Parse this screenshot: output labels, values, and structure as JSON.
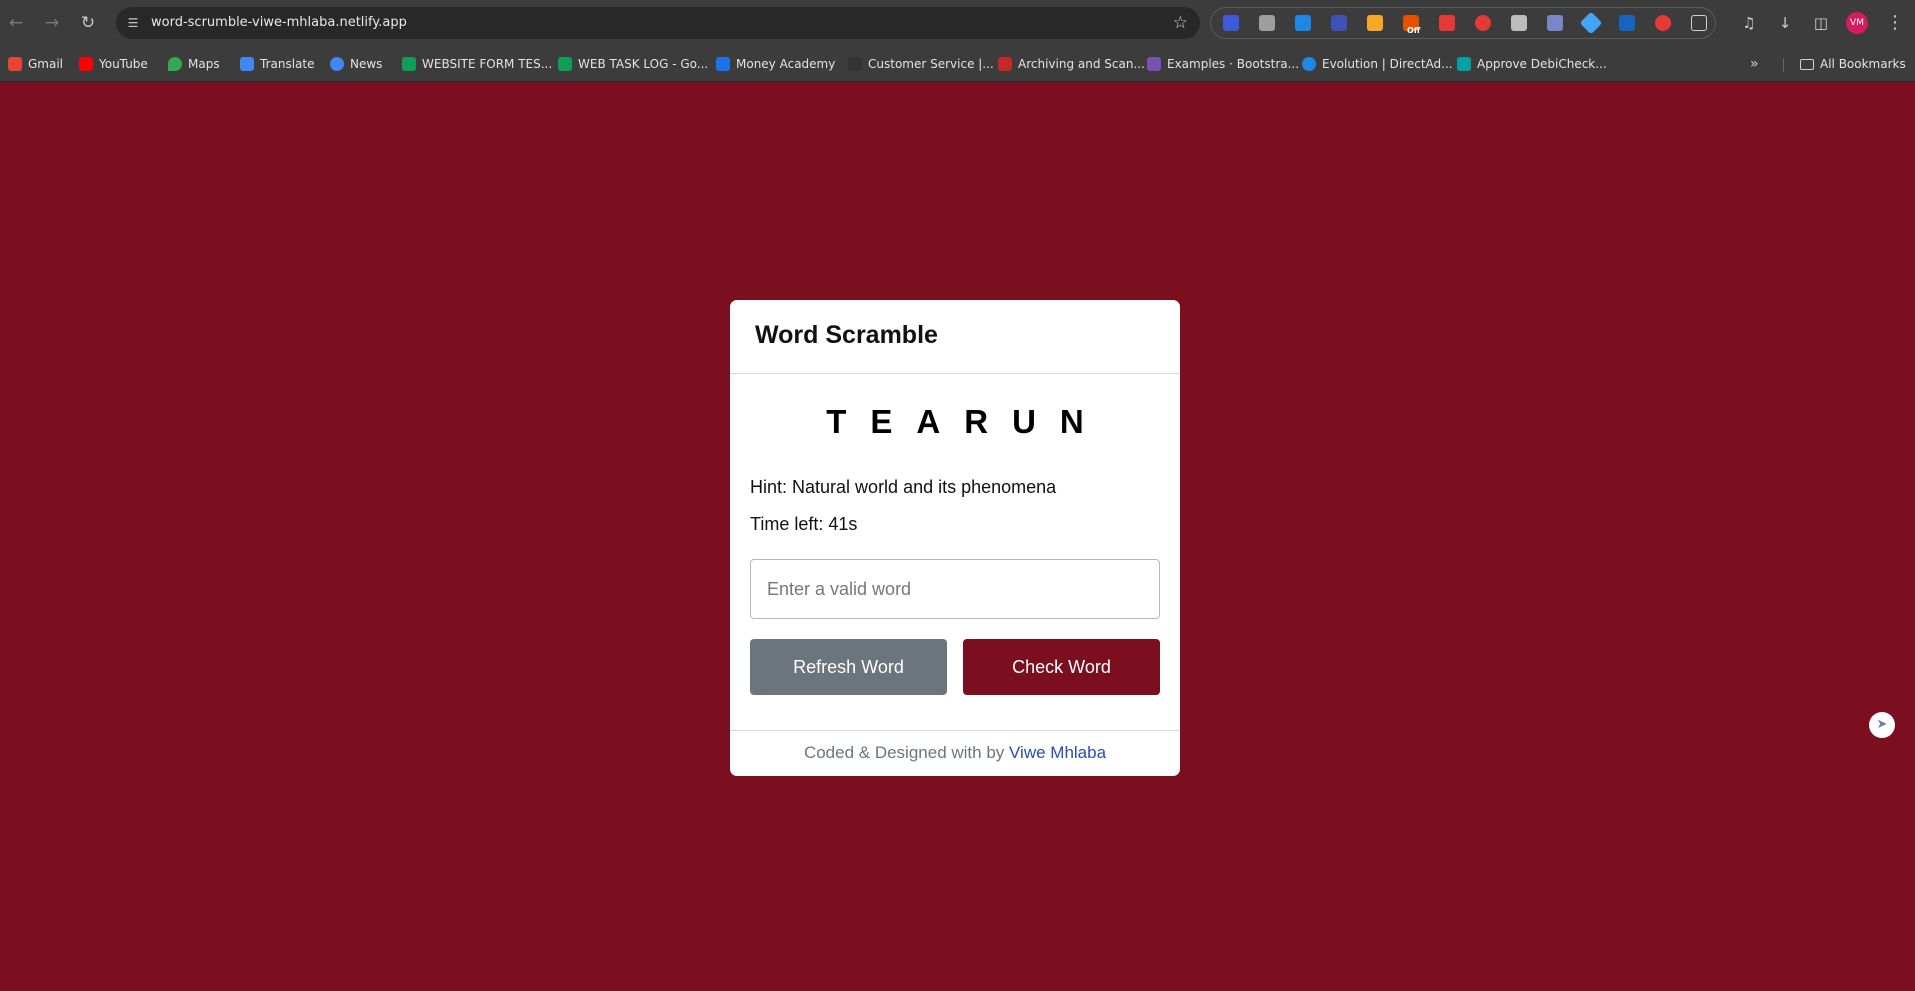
{
  "browser": {
    "url": "word-scrumble-viwe-mhlaba.netlify.app",
    "nav_icons": [
      "back-arrow-icon",
      "forward-arrow-icon",
      "reload-icon"
    ],
    "extension_badge": "Off",
    "profile_initials": "VM",
    "bookmarks": [
      {
        "label": "Gmail",
        "color": "#ea4335"
      },
      {
        "label": "YouTube",
        "color": "#ff0000"
      },
      {
        "label": "Maps",
        "color": "#34a853"
      },
      {
        "label": "Translate",
        "color": "#4285f4"
      },
      {
        "label": "News",
        "color": "#4285f4"
      },
      {
        "label": "WEBSITE FORM TES...",
        "color": "#0f9d58"
      },
      {
        "label": "WEB TASK LOG - Go...",
        "color": "#0f9d58"
      },
      {
        "label": "Money Academy",
        "color": "#1a73e8"
      },
      {
        "label": "Customer Service |...",
        "color": "#333333"
      },
      {
        "label": "Archiving and Scan...",
        "color": "#c62828"
      },
      {
        "label": "Examples · Bootstra...",
        "color": "#7952b3"
      },
      {
        "label": "Evolution | DirectAd...",
        "color": "#1e88e5"
      },
      {
        "label": "Approve DebiCheck...",
        "color": "#00a3a3"
      }
    ],
    "all_bookmarks_label": "All Bookmarks"
  },
  "game": {
    "title": "Word Scramble",
    "scrambled_word": "TEARUN",
    "hint_label": "Hint:",
    "hint_text": "Natural world and its phenomena",
    "time_label": "Time left:",
    "time_value": "41s",
    "input_placeholder": "Enter a valid word",
    "refresh_button": "Refresh Word",
    "check_button": "Check Word"
  },
  "footer": {
    "prefix": "Coded & Designed with by",
    "author": "Viwe Mhlaba"
  },
  "colors": {
    "page_background": "#7b0f1f",
    "refresh_button": "#6c757d",
    "check_button": "#7b0f1f",
    "author_link": "#2b4bb3"
  }
}
